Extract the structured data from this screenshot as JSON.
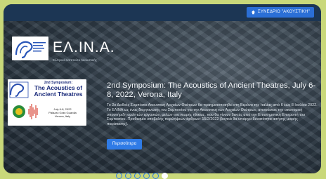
{
  "header": {
    "symposium_button": "ΣΥΝΕΔΡΙΟ \"ΑΚΟΥΣΤΙΚΗ\""
  },
  "logo": {
    "name": "ΕΛ.ΙΝ.Α.",
    "subtitle": "Ελληνικό Ινστιτούτο Ακουστικής"
  },
  "poster": {
    "line1": "2nd Symposium:",
    "line2": "The Acoustics of Ancient Theatres",
    "info": "July 6-8, 2022\nPalazzo Gran Guardia\nVerona, Italy"
  },
  "slide": {
    "title": "2nd Symposium: The Acoustics of Ancient Theatres, July 6-8, 2022, Verona, Italy",
    "description": "Το 2ο Διεθνές Συμπόσιο Ακουστική Αρχαίων Θεάτρων θα πραγματοποιηθεί στη Βερόνα της Ιταλίας από 6 έως 8 Ιουλίου 2022. Το ΕΛΙΝΑ ως ένας διοργανωτής του Συμποσίου για την Ακουστική των Αρχαίων Θεάτρων, αποφάσισε την οικονομική υποστήριξη ομιλητών εργασιών, μελών του νεαρής ηλικίας, που θα γίνουν δεκτές από την Επιστημονική Επιτροπή του Συμποσίου. Προθεσμία υποβολής περιλήψεων άρθρων: 15/2/2022 (λογικά θα υπάρχει δυνατότητα αιτήσης μικρής παράτασης).",
    "more_button": "Περισσότερα"
  },
  "carousel": {
    "total": 6,
    "active_index": 5
  },
  "colors": {
    "accent": "#2f7be6",
    "topbar": "#1c3654",
    "outer": "#c9d87a"
  }
}
